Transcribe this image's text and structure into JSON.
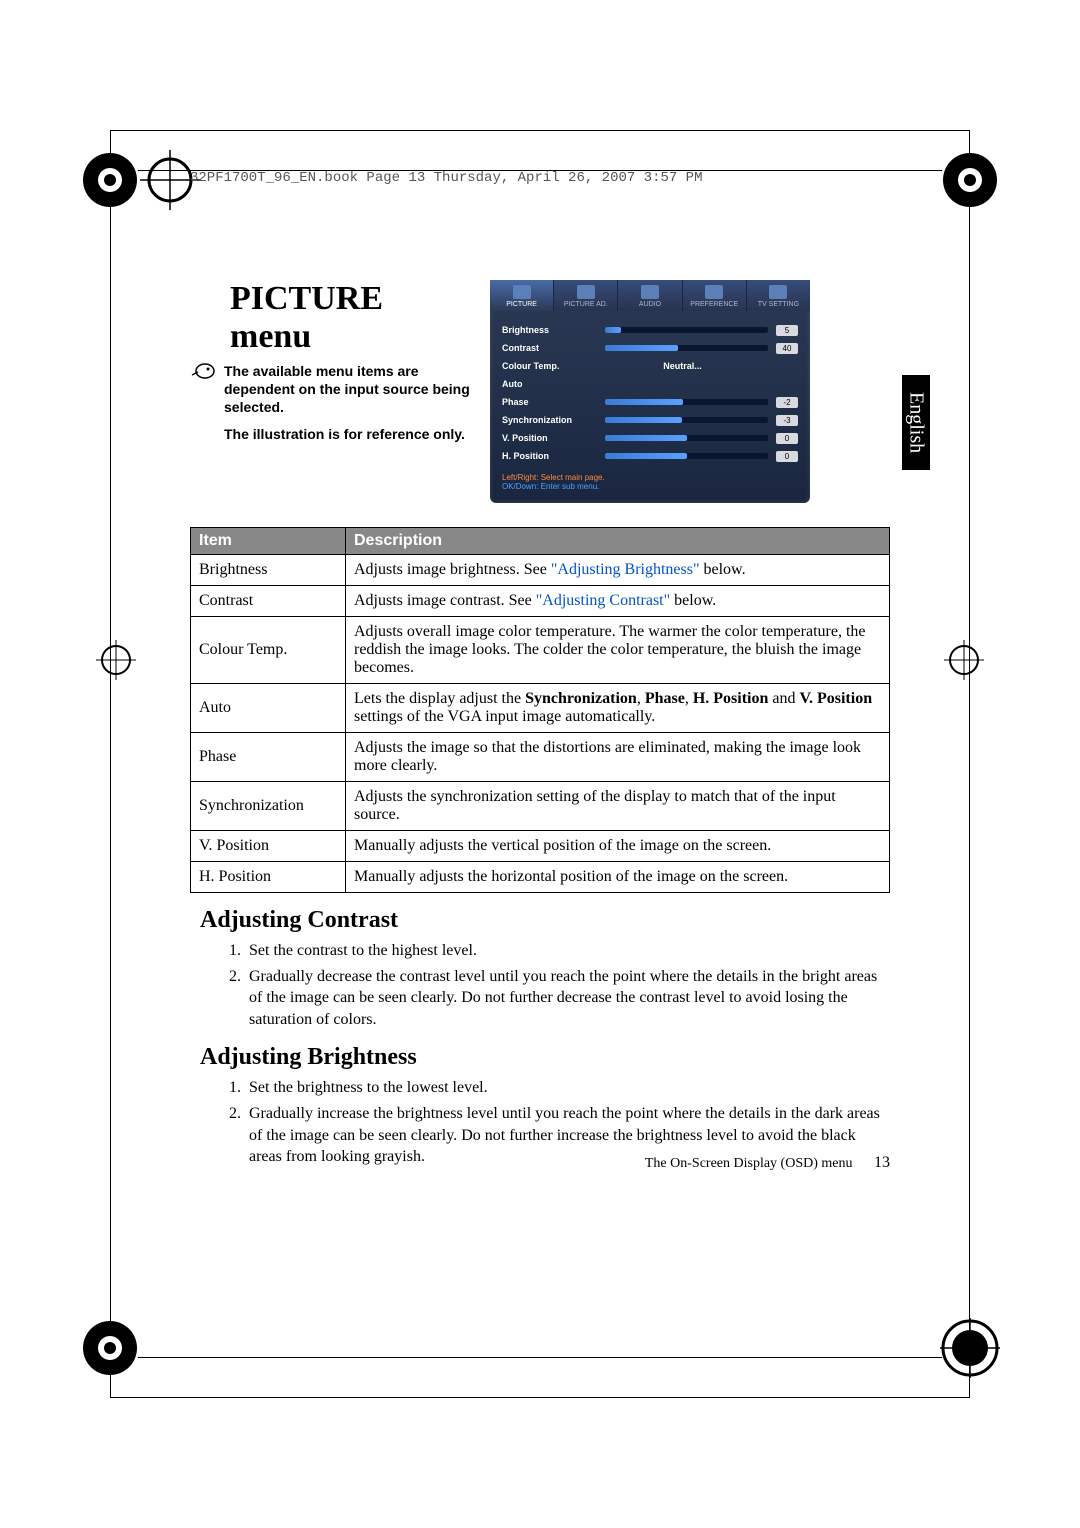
{
  "bookmark_text": "32PF1700T_96_EN.book  Page 13  Thursday, April 26, 2007  3:57 PM",
  "menu_title": "PICTURE menu",
  "note_line1": "The available menu items are dependent on the input source being selected.",
  "note_line2": "The illustration is for reference only.",
  "language_tab": "English",
  "osd": {
    "tabs": [
      "PICTURE",
      "PICTURE AD.",
      "AUDIO",
      "PREFERENCE",
      "TV SETTING"
    ],
    "rows": [
      {
        "label": "Brightness",
        "value": "5",
        "fill": 10,
        "type": "bar"
      },
      {
        "label": "Contrast",
        "value": "40",
        "fill": 45,
        "type": "bar"
      },
      {
        "label": "Colour Temp.",
        "text": "Neutral...",
        "type": "text"
      },
      {
        "label": "Auto",
        "type": "label"
      },
      {
        "label": "Phase",
        "value": "-2",
        "fill": 48,
        "type": "bar"
      },
      {
        "label": "Synchronization",
        "value": "-3",
        "fill": 47,
        "type": "bar"
      },
      {
        "label": "V. Position",
        "value": "0",
        "fill": 50,
        "type": "bar"
      },
      {
        "label": "H. Position",
        "value": "0",
        "fill": 50,
        "type": "bar"
      }
    ],
    "hint1": "Left/Right: Select main page.",
    "hint2": "OK/Down: Enter sub menu."
  },
  "table": {
    "head_item": "Item",
    "head_desc": "Description",
    "rows": [
      {
        "item": "Brightness",
        "desc_pre": "Adjusts image brightness. See ",
        "link": "\"Adjusting Brightness\"",
        "desc_post": " below."
      },
      {
        "item": "Contrast",
        "desc_pre": "Adjusts image contrast. See ",
        "link": "\"Adjusting Contrast\"",
        "desc_post": " below."
      },
      {
        "item": "Colour Temp.",
        "desc": "Adjusts overall image color temperature. The warmer the color temperature, the reddish the image looks. The colder the color temperature, the bluish the image becomes."
      },
      {
        "item": "Auto",
        "desc_html": "Lets the display adjust the <b>Synchronization</b>, <b>Phase</b>, <b>H. Position</b> and <b>V. Position</b> settings of the VGA input image automatically."
      },
      {
        "item": "Phase",
        "desc": "Adjusts the image so that the distortions are eliminated, making the image look more clearly."
      },
      {
        "item": "Synchronization",
        "desc": "Adjusts the synchronization setting of the display to match that of the input source."
      },
      {
        "item": "V. Position",
        "desc": "Manually adjusts the vertical position of the image on the screen."
      },
      {
        "item": "H. Position",
        "desc": "Manually adjusts the horizontal position of the image on the screen."
      }
    ]
  },
  "sections": {
    "contrast_title": "Adjusting Contrast",
    "contrast_steps": [
      "Set the contrast to the highest level.",
      "Gradually decrease the contrast level until you reach the point where the details in the bright areas of the image can be seen clearly. Do not further decrease the contrast level to avoid losing the saturation of colors."
    ],
    "brightness_title": "Adjusting Brightness",
    "brightness_steps": [
      "Set the brightness to the lowest level.",
      "Gradually increase the brightness level until you reach the point where the details in the dark areas of the image can be seen clearly. Do not further increase the brightness level to avoid the black areas from looking grayish."
    ]
  },
  "footer_text": "The On-Screen Display (OSD) menu",
  "page_number": "13"
}
